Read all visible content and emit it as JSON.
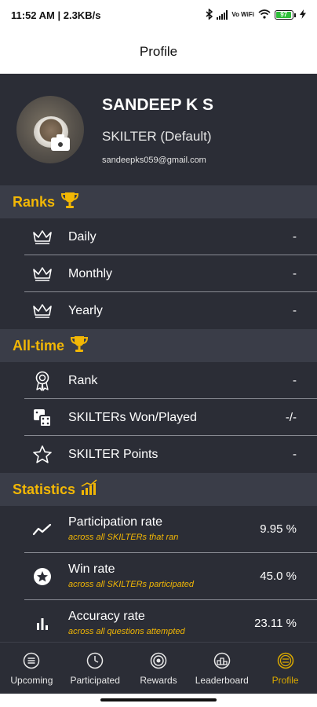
{
  "status_bar": {
    "left_text": "11:52 AM | 2.3KB/s",
    "wifi_label": "Vo WiFi",
    "battery_text": "97",
    "battery_level": 0.97
  },
  "header": {
    "title": "Profile"
  },
  "profile": {
    "name": "SANDEEP K S",
    "role": "SKILTER (Default)",
    "email": "sandeepks059@gmail.com"
  },
  "ranks": {
    "title": "Ranks",
    "rows": [
      {
        "label": "Daily",
        "value": "-"
      },
      {
        "label": "Monthly",
        "value": "-"
      },
      {
        "label": "Yearly",
        "value": "-"
      }
    ]
  },
  "alltime": {
    "title": "All-time",
    "rows": [
      {
        "label": "Rank",
        "value": "-"
      },
      {
        "label": "SKILTERs Won/Played",
        "value": "-/-"
      },
      {
        "label": "SKILTER Points",
        "value": "-"
      }
    ]
  },
  "statistics": {
    "title": "Statistics",
    "rows": [
      {
        "label": "Participation rate",
        "sub": "across all SKILTERs that ran",
        "value": "9.95 %"
      },
      {
        "label": "Win rate",
        "sub": "across all SKILTERs participated",
        "value": "45.0 %"
      },
      {
        "label": "Accuracy rate",
        "sub": "across all questions attempted",
        "value": "23.11 %"
      }
    ]
  },
  "nav": {
    "items": [
      {
        "label": "Upcoming",
        "icon": "menu-circle-icon"
      },
      {
        "label": "Participated",
        "icon": "clock-icon"
      },
      {
        "label": "Rewards",
        "icon": "target-icon"
      },
      {
        "label": "Leaderboard",
        "icon": "podium-icon"
      },
      {
        "label": "Profile",
        "icon": "profile-icon"
      }
    ],
    "active_index": 4
  },
  "colors": {
    "accent": "#f2b705",
    "background": "#2b2d36",
    "section_header": "#3a3d48",
    "divider": "#8a8c94"
  }
}
